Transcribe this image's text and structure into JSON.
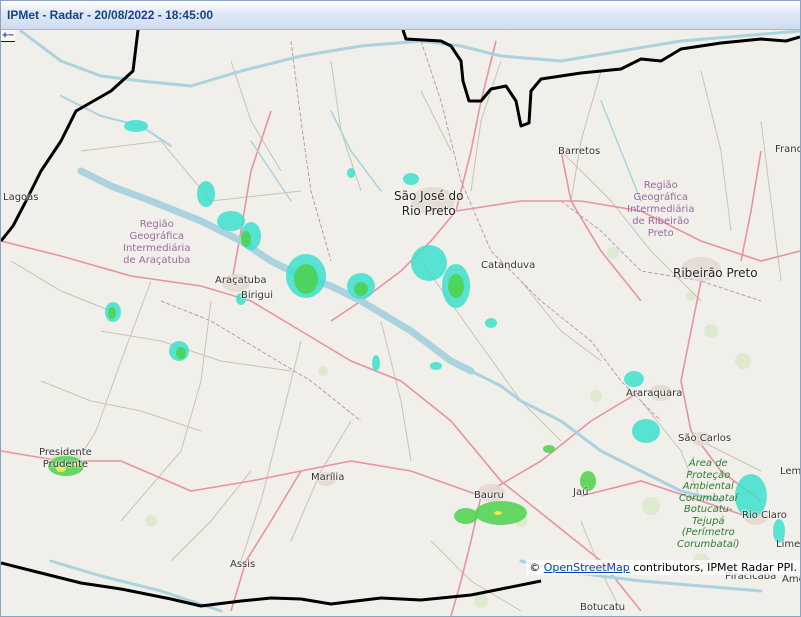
{
  "window": {
    "title": "IPMet - Radar - 20/08/2022 - 18:45:00"
  },
  "map": {
    "zoom_control_label": "+−",
    "attribution": {
      "prefix": "© ",
      "link_text": "OpenStreetMap",
      "suffix": " contributors, IPMet Radar PPI."
    },
    "places": {
      "sao_jose": "São José do\nRio Preto",
      "barretos": "Barretos",
      "franca": "Franc",
      "ribeirao": "Ribeirão Preto",
      "catanduva": "Catanduva",
      "aracatuba": "Araçatuba",
      "birigui": "Birigui",
      "lagoas": "Lagoas",
      "araraquara": "Araraquara",
      "sao_carlos": "São Carlos",
      "presidente": "Presidente\nPrudente",
      "marilia": "Marília",
      "bauru": "Bauru",
      "jau": "Jaú",
      "rio_claro": "Rio Claro",
      "limeira": "Limei",
      "lem": "Lem",
      "piracicaba": "Piracicaba",
      "ame": "Ame",
      "assis": "Assis",
      "botucatu": "Botucatu"
    },
    "regions": {
      "aracatuba_region": "Região\nGeográfica\nIntermediária\nde Araçatuba",
      "ribeirao_region": "Região\nGeográfica\nIntermediária\nde Ribeirão\nPreto"
    },
    "protected_area": "Área de\nProteção\nAmbiental\nCorumbataí\nBotucatu-\nTejupá\n(Perímetro\nCorumbataí)",
    "colors": {
      "land": "#f1efe9",
      "water": "#aad3df",
      "state_border": "#000000",
      "trunk_road": "#e892a2",
      "minor_road": "#c9c3b6",
      "region_border": "#b79bb8",
      "radar_light": "#3ee0cf",
      "radar_moderate": "#4cd24c",
      "radar_heavy": "#ffe84a"
    }
  }
}
